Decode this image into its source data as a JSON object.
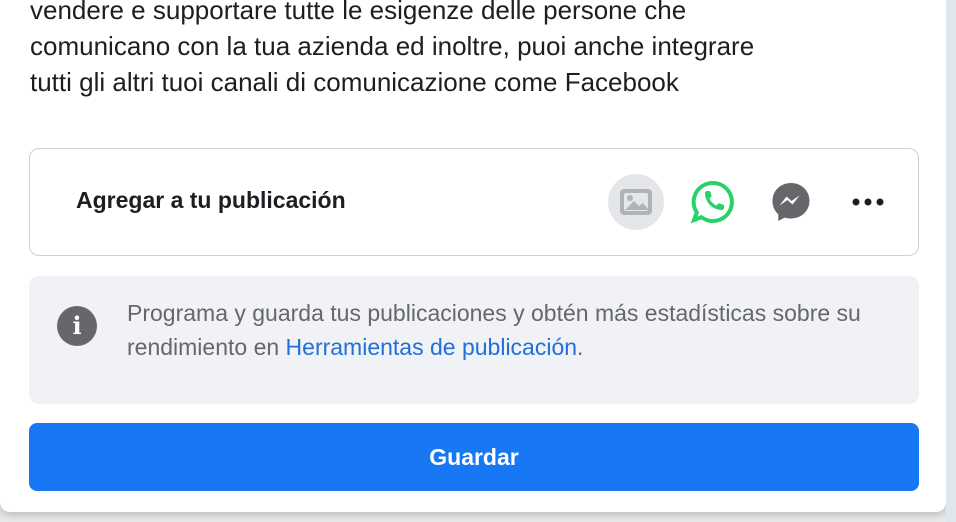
{
  "post": {
    "text": "vendere e supportare tutte le esigenze delle persone che\ncomunicano con la tua azienda ed inoltre, puoi anche integrare\ntutti gli altri tuoi canali di comunicazione come Facebook"
  },
  "add_to_post": {
    "label": "Agregar a tu publicación",
    "icons": [
      "photo-icon",
      "whatsapp-icon",
      "messenger-icon",
      "more-icon"
    ],
    "whatsapp_color": "#25d366",
    "messenger_color": "#65676b"
  },
  "info": {
    "text_before_link": "Programa y guarda tus publicaciones y obtén más estadísticas sobre su rendimiento en ",
    "link_text": "Herramientas de publicación",
    "text_after_link": "."
  },
  "save_button": {
    "label": "Guardar",
    "color": "#1877f2"
  }
}
